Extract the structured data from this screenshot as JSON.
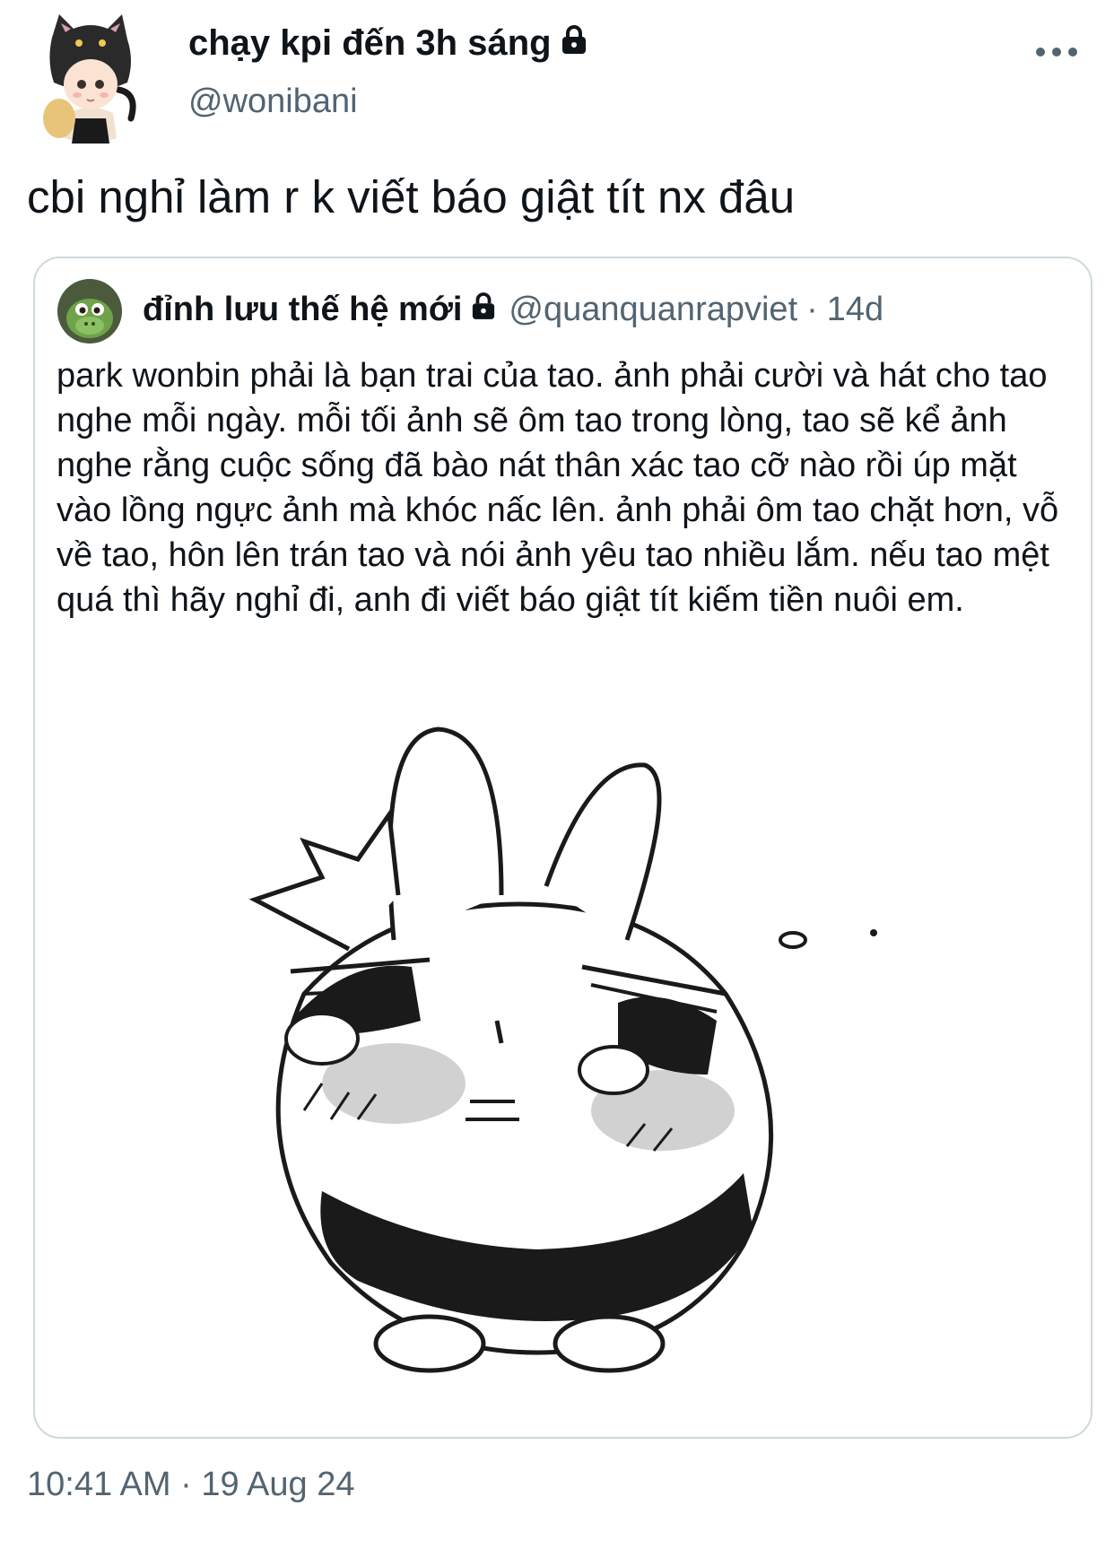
{
  "tweet": {
    "author": {
      "display_name": "chạy kpi đến 3h sáng",
      "handle": "@wonibani",
      "protected": true,
      "avatar": "chibi-figure-with-black-cat-hood"
    },
    "text": "cbi nghỉ làm r k viết báo giật tít nx đâu",
    "timestamp": "10:41 AM · 19 Aug 24",
    "more_icon": "more-dots-icon"
  },
  "quote": {
    "author": {
      "display_name": "đỉnh lưu thế hệ mới",
      "handle": "@quanquanrapviet",
      "protected": true,
      "avatar": "green-dinosaur-avatar"
    },
    "separator": "·",
    "time": "14d",
    "text": "park wonbin phải là bạn trai của tao. ảnh phải cười và hát cho tao nghe mỗi ngày. mỗi tối ảnh sẽ ôm tao trong lòng, tao sẽ kể ảnh nghe rằng cuộc sống đã bào nát thân xác tao cỡ nào rồi úp mặt vào lồng ngực ảnh mà khóc nấc lên. ảnh phải ôm tao chặt hơn, vỗ về tao, hôn lên trán tao và nói ảnh yêu tao nhiều lắm. nếu tao mệt quá thì hãy nghỉ đi, anh đi viết báo giật tít kiếm tiền nuôi em.",
    "media": "crying-bunny-sketch"
  },
  "colors": {
    "text_primary": "#0f1419",
    "text_secondary": "#536471",
    "border": "#cfd9de"
  }
}
